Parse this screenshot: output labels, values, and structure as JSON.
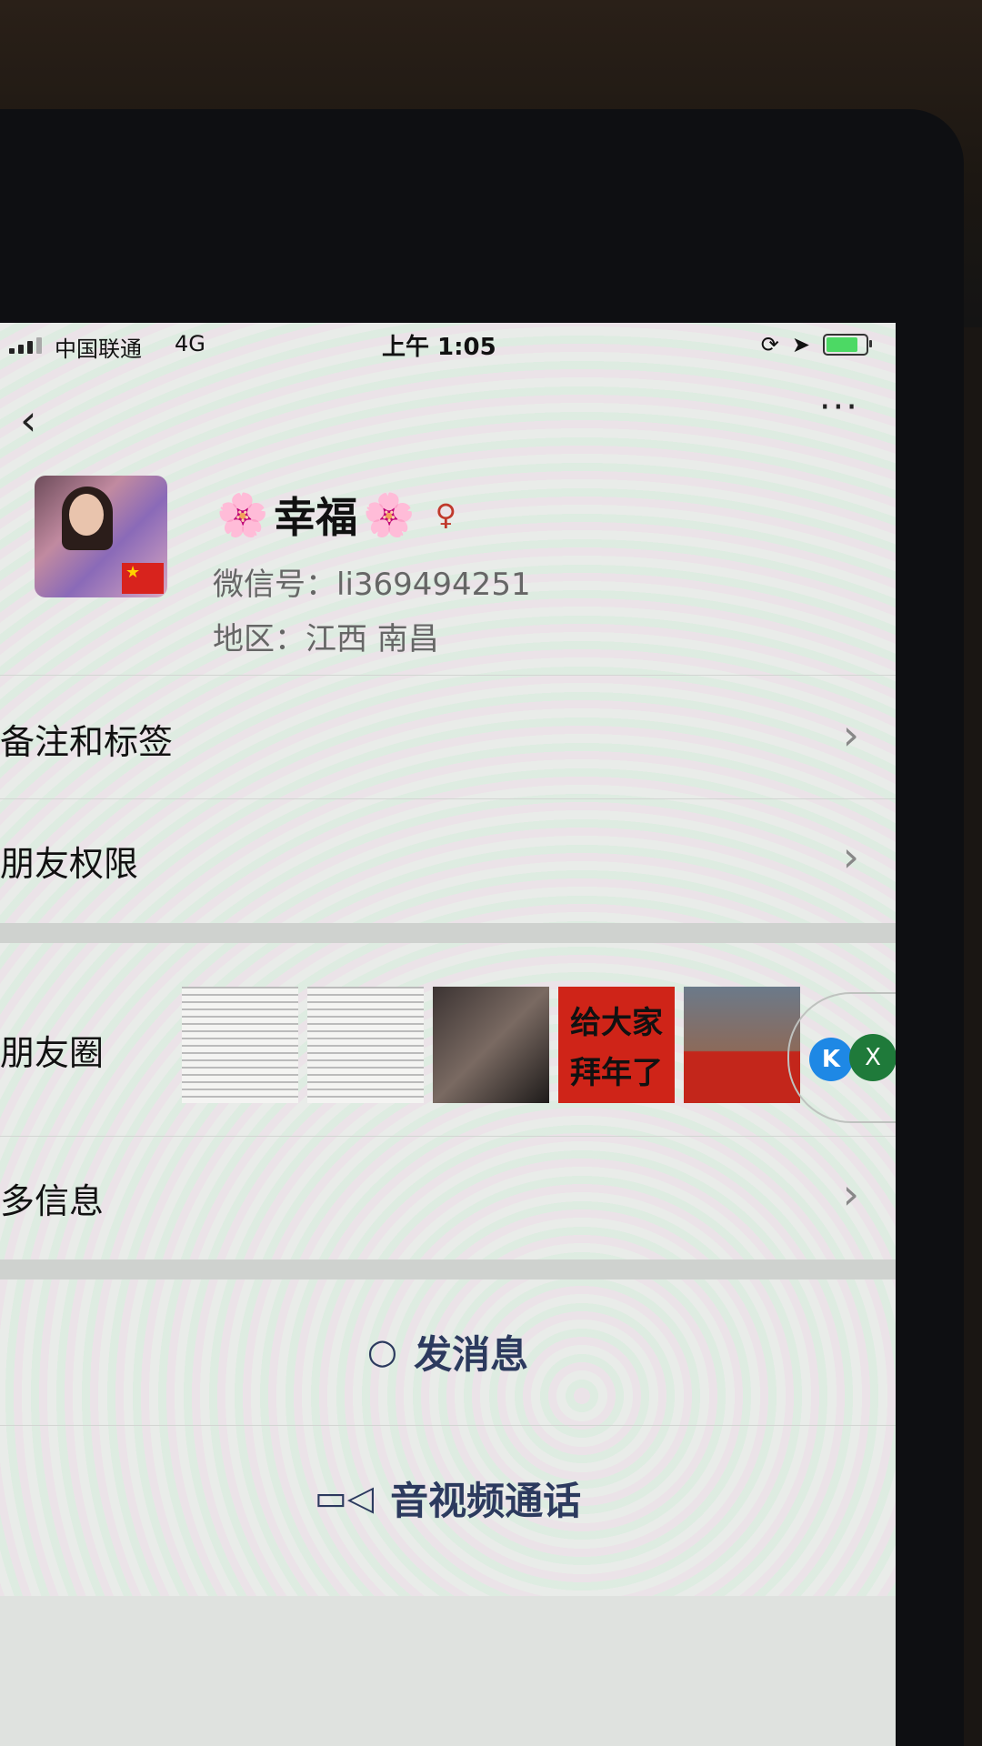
{
  "status_bar": {
    "carrier": "中国联通",
    "network": "4G",
    "time": "上午 1:05",
    "battery_color": "#4cd964"
  },
  "nav": {
    "back_icon": "‹",
    "more_icon": "···"
  },
  "profile": {
    "flower_icon": "🌸",
    "nickname": "幸福",
    "gender_icon": "♀",
    "wechat_id": "微信号：li369494251",
    "region": "地区：江西 南昌"
  },
  "menu": {
    "remarks_label": "备注和标签",
    "permissions_label": "朋友权限",
    "moments_label": "朋友圈",
    "more_info_label": "多信息",
    "chevron": "›"
  },
  "moments_thumb_text": {
    "greeting_line1": "给大家",
    "greeting_line2": "拜年了"
  },
  "float_chip": {
    "k_label": "K",
    "x_label": "X"
  },
  "actions": {
    "message_icon": "○",
    "message_label": "发消息",
    "call_icon": "▭◁",
    "call_label": "音视频通话"
  },
  "colors": {
    "action_text": "#2c3a5e",
    "screen_bg": "#e9ece9"
  }
}
